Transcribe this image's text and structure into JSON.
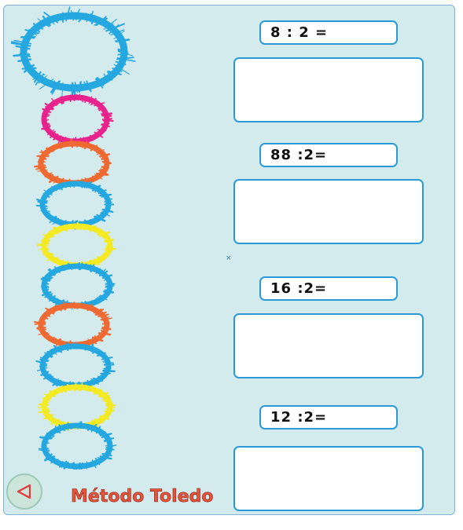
{
  "exercises": [
    {
      "operation": "8 : 2 =",
      "answer": ""
    },
    {
      "operation": "88 :2=",
      "answer": ""
    },
    {
      "operation": "16 :2=",
      "answer": ""
    },
    {
      "operation": "12 :2=",
      "answer": ""
    }
  ],
  "footer": {
    "brand": "Método Toledo",
    "back_icon": "triangle-left-icon"
  },
  "caterpillar": {
    "segments": [
      {
        "color": "#25a7e0"
      },
      {
        "color": "#e8238c"
      },
      {
        "color": "#ee6a32"
      },
      {
        "color": "#25a7e0"
      },
      {
        "color": "#f4ea24"
      },
      {
        "color": "#25a7e0"
      },
      {
        "color": "#ee6a32"
      },
      {
        "color": "#25a7e0"
      },
      {
        "color": "#f4ea24"
      },
      {
        "color": "#25a7e0"
      }
    ]
  },
  "colors": {
    "panel_bg": "#d4ebee",
    "box_border": "#2a9ad6",
    "brand": "#e4543b",
    "back_button_bg": "#cbe5da",
    "back_icon": "#e63a3a"
  }
}
